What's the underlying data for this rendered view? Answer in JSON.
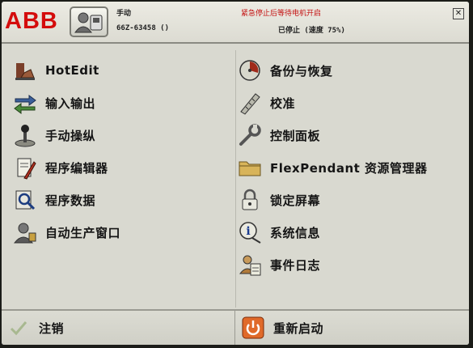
{
  "brand": {
    "logo_text": "ABB",
    "logo_color": "#d40c0c"
  },
  "status_bar": {
    "mode": "手动",
    "warning": "紧急停止后等待电机开启",
    "controller_id": "66Z-63458 ()",
    "state": "已停止 (速度 75%)",
    "warning_color": "#c41010"
  },
  "menu": {
    "left": [
      {
        "label": "HotEdit",
        "icon": "hotedit-icon"
      },
      {
        "label": "输入输出",
        "icon": "io-icon"
      },
      {
        "label": "手动操纵",
        "icon": "joystick-icon"
      },
      {
        "label": "程序编辑器",
        "icon": "program-editor-icon"
      },
      {
        "label": "程序数据",
        "icon": "program-data-icon"
      },
      {
        "label": "自动生产窗口",
        "icon": "production-window-icon"
      }
    ],
    "right": [
      {
        "label": "备份与恢复",
        "icon": "backup-restore-icon"
      },
      {
        "label": "校准",
        "icon": "calibration-icon"
      },
      {
        "label": "控制面板",
        "icon": "control-panel-icon"
      },
      {
        "label": "FlexPendant 资源管理器",
        "icon": "folder-icon"
      },
      {
        "label": "锁定屏幕",
        "icon": "lock-icon"
      },
      {
        "label": "系统信息",
        "icon": "info-icon"
      },
      {
        "label": "事件日志",
        "icon": "event-log-icon"
      }
    ]
  },
  "footer": {
    "logout_label": "注销",
    "restart_label": "重新启动"
  }
}
